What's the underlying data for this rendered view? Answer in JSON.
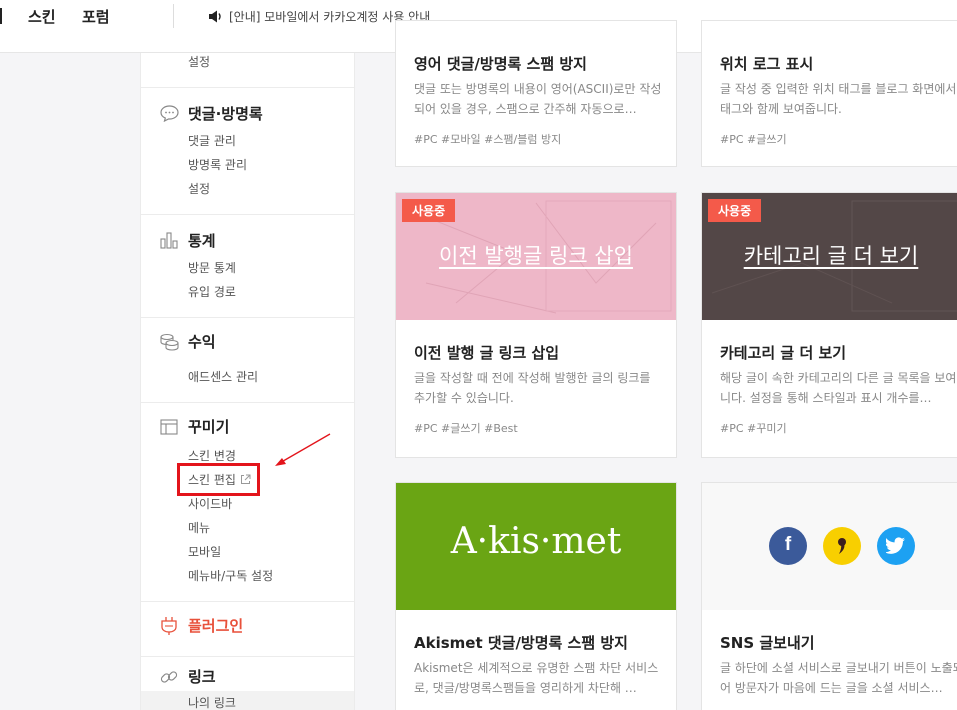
{
  "topbar": {
    "nav": [
      "스킨",
      "포럼"
    ],
    "notice": "[안내] 모바일에서 카카오계정 사용 안내"
  },
  "sidebar": {
    "top_sub": "설정",
    "sections": [
      {
        "title": "댓글·방명록",
        "icon": "speech-bubble-icon",
        "items": [
          "댓글 관리",
          "방명록 관리",
          "설정"
        ]
      },
      {
        "title": "통계",
        "icon": "bar-chart-icon",
        "items": [
          "방문 통계",
          "유입 경로"
        ]
      },
      {
        "title": "수익",
        "icon": "coins-icon",
        "items": [
          "애드센스 관리"
        ]
      },
      {
        "title": "꾸미기",
        "icon": "layout-icon",
        "items": [
          "스킨 변경",
          "스킨 편집",
          "사이드바",
          "메뉴",
          "모바일",
          "메뉴바/구독 설정"
        ]
      },
      {
        "title": "플러그인",
        "icon": "plug-icon",
        "items": []
      },
      {
        "title": "링크",
        "icon": "link-icon",
        "items": [
          "나의 링크"
        ]
      }
    ],
    "plugin_color": "#e8513b"
  },
  "cards": [
    {
      "title": "영어 댓글/방명록 스팸 방지",
      "desc": "댓글 또는 방명록의 내용이 영어(ASCII)로만 작성되어 있을 경우, 스팸으로 간주해 자동으로…",
      "tags": "#PC  #모바일  #스팸/블럼 방지"
    },
    {
      "title": "위치 로그 표시",
      "desc": "글 작성 중 입력한 위치 태그를 블로그 화면에서 태그와 함께 보여줍니다.",
      "tags": "#PC  #글쓰기"
    },
    {
      "title": "이전 발행 글 링크 삽입",
      "desc": "글을 작성할 때 전에 작성해 발행한 글의 링크를 추가할 수 있습니다.",
      "tags": "#PC  #글쓰기  #Best",
      "badge": "사용중",
      "thumb_text": "이전 발행글 링크 삽입",
      "thumb_color": "#eeb7c8"
    },
    {
      "title": "카테고리 글 더 보기",
      "desc": "해당 글이 속한 카테고리의 다른 글 목록을 보여줍니다. 설정을 통해 스타일과 표시 개수를…",
      "tags": "#PC  #꾸미기",
      "badge": "사용중",
      "thumb_text": "카테고리 글 더 보기",
      "thumb_color": "#534747"
    },
    {
      "title": "Akismet 댓글/방명록 스팸 방지",
      "desc": "Akismet은 세계적으로 유명한 스팸 차단 서비스로, 댓글/방명록스팸들을 영리하게 차단해 …",
      "thumb_text": "A·kis·met",
      "thumb_color": "#6aa514"
    },
    {
      "title": "SNS 글보내기",
      "desc": "글 하단에 소셜 서비스로 글보내기 버튼이 노출되어 방문자가 마음에 드는 글을 소셜 서비스…",
      "thumb_color": "#f8f8f8",
      "social_icons": [
        "facebook-icon",
        "kakaostory-icon",
        "twitter-icon"
      ]
    }
  ]
}
